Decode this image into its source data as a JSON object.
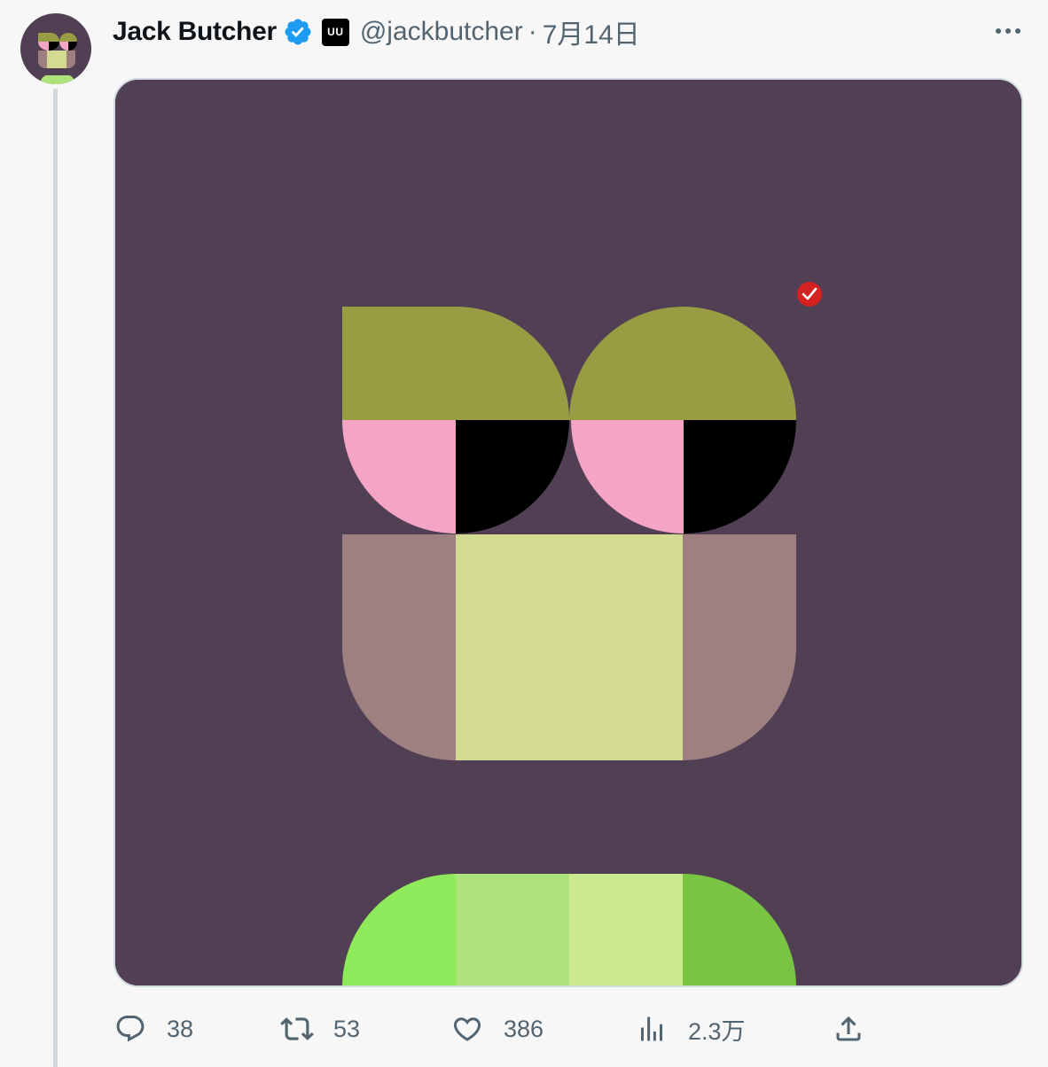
{
  "user": {
    "display_name": "Jack Butcher",
    "verified_icon": "verified-badge-icon",
    "affiliate_badge": "UU",
    "handle": "@jackbutcher",
    "separator": "·",
    "date": "7月14日"
  },
  "menu": {
    "more_icon": "more-horizontal-icon"
  },
  "media": {
    "background": "#513f54",
    "brow": "#989c43",
    "eye_left": "#f4a4c4",
    "pupil": "#000000",
    "cheek": "#9e8081",
    "mouth": "#d3db92",
    "body_colors": [
      "#8eea5a",
      "#aee37b",
      "#cbea90",
      "#79c443"
    ],
    "mark_icon": "red-check-icon"
  },
  "actions": {
    "reply_count": "38",
    "retweet_count": "53",
    "like_count": "386",
    "views_count": "2.3万"
  },
  "colors": {
    "verified_blue": "#1d9bf0",
    "secondary_text": "#536471",
    "thread_line": "#cfd9de"
  }
}
